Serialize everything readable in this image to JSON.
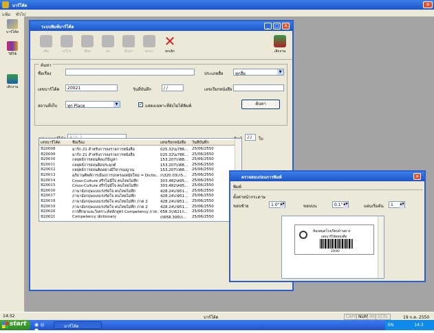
{
  "main_window": {
    "title": "บาร์โค้ด",
    "menu": [
      "แฟ้ม",
      "ทั่วไป"
    ]
  },
  "left_rail": [
    {
      "label": "บาร์โค้ด",
      "icon": "barcode-tool-icon"
    },
    {
      "label": "วิธีใช้",
      "icon": "books-icon"
    },
    {
      "label": "เลิกงาน",
      "icon": "exit-door-icon"
    }
  ],
  "inner_window": {
    "title": "ระบบพิมพ์บาร์โค้ด",
    "toolbar": [
      {
        "label": "เพิ่ม",
        "icon": "add-icon"
      },
      {
        "label": "แก้ไข",
        "icon": "edit-pencil-icon"
      },
      {
        "label": "เลือก",
        "icon": "select-icon"
      },
      {
        "label": "ลบ",
        "icon": "delete-icon"
      },
      {
        "label": "ค้นหา",
        "icon": "search-binoculars-icon"
      },
      {
        "label": "ตกลง",
        "icon": "check-icon"
      },
      {
        "label": "ยกเลิก",
        "icon": "cancel-x-icon"
      },
      {
        "label": "เลิกงาน",
        "icon": "exit-door-icon"
      }
    ],
    "search": {
      "group_label": "ค้นหา",
      "title_label": "ชื่อเรื่อง",
      "title_value": "",
      "type_label": "ประเภทสื่อ",
      "type_value": "ทุกสื่อ",
      "regno_label": "เลขบาร์โค้ด",
      "regno_value": "20021",
      "date_label": "วันที่บันทึก",
      "date_value": "/ /",
      "callno_label": "เลขเรียกหนังสือ",
      "callno_value": "",
      "place_label": "สถานที่เก็บ",
      "place_value": "ทุก Place",
      "checkbox_label": "แสดงเฉพาะที่ยังไม่ได้พิมพ์",
      "checkbox_checked": "✓",
      "search_button": "ค้นหา"
    },
    "format": {
      "label": "รูปแบบบาร์โค้ด",
      "value": "A10_2",
      "count_label": "พิมพ์",
      "count_value": "22",
      "unit": "ใบ"
    },
    "table": {
      "columns": [
        "เลขบาร์โค้ด",
        "ชื่อเรื่อง",
        "เลขเรียกหนังสือ",
        "วันที่บันทึก"
      ],
      "rows": [
        [
          "B20008",
          "มาร์ก 21 สำหรับการลงรายการหนังสือ",
          "025.32\\ม786...",
          "25/06/2550"
        ],
        [
          "B20009",
          "มาร์ก 21 สำหรับการลงรายการหนังสือ",
          "025.32\\ม786...",
          "25/06/2550"
        ],
        [
          "B20010",
          "กลยุทธ์การสอนคิดแก้ปัญหา",
          "153.207\\ก88...",
          "25/06/2550"
        ],
        [
          "B20011",
          "กลยุทธ์การสอนคิดประยุกต์",
          "153.207\\ก88...",
          "25/06/2550"
        ],
        [
          "B20012",
          "กลยุทธ์การสอนคิดอย่างมีวิจารณญาณ",
          "153.207\\ก88...",
          "25/06/2550"
        ],
        [
          "B20013",
          "อภิธานศัพท์การเมืองการปกครองสมัยใหม่ = Dictio...",
          "ก\\320.03\\ก5...",
          "25/06/2550"
        ],
        [
          "B20014",
          "Cross-Culture สรีรไม่มีใจ คนไทยไม่ทึก",
          "303.482\\ค95...",
          "25/06/2550"
        ],
        [
          "B20015",
          "Cross-Culture สรีรไม่มีใจ คนไทยไม่ทึก",
          "303.482\\ค95...",
          "25/06/2550"
        ],
        [
          "B20016",
          "ภาษาอังกฤษแบบเร่งรัดใจ คนไทยไม่ทึก",
          "428.24\\ภ951...",
          "25/06/2550"
        ],
        [
          "B20017",
          "ภาษาอังกฤษแบบเร่งรัดใจ คนไทยไม่ทึก",
          "428.24\\ภ951...",
          "25/06/2550"
        ],
        [
          "B20018",
          "ภาษาอังกฤษแบบเร่งรัดใจ คนไทยไม่ทึก ภาค 2",
          "428.24\\ภ951...",
          "25/06/2550"
        ],
        [
          "B20019",
          "ภาษาอังกฤษแบบเร่งรัดใจ คนไทยไม่ทึก ภาค 2",
          "428.24\\ภ951...",
          "25/06/2550"
        ],
        [
          "B20020",
          "การศึกษาและวิเคราะห์หลักสูตร Competency ภาค...",
          "658.3\\ก621ก...",
          "25/06/2550"
        ],
        [
          "B20021",
          "Competency dictionary",
          "ก\\658.306\\ก...",
          "25/06/2550"
        ]
      ]
    }
  },
  "print_dialog": {
    "title": "ตรวจสอบก่อนการพิมพ์",
    "menu": "พิมพ์",
    "group_label": "ตั้งค่าหน้ากระดาษ",
    "margin_left_label": "ขอบซ้าย",
    "margin_left_value": "1.0\"",
    "margin_top_label": "ขอบบน",
    "margin_top_value": "0.1\"",
    "start_label": "แผ่นเริ่มต้น",
    "start_value": "1",
    "label_line1": "ห้องสมุดโรงเรียนบ้านยาง",
    "label_line2": "เลขบาร์โค้ดหนังสือ",
    "label_code": "20000"
  },
  "status_bar": {
    "time": "14:32",
    "center": "บาร์โค้ด",
    "caps": "CAPS",
    "num": "NUM",
    "ins": "INS",
    "scrl": "SCRL",
    "date": "19 ก.ค. 2550"
  },
  "taskbar": {
    "start": "start",
    "app": "บาร์โค้ด",
    "lang": "EN",
    "clock": "14:3"
  },
  "colors": {
    "titlebar": "#2458d8",
    "workspace": "#a4a4a4",
    "window_bg": "#ece9d8",
    "close_red": "#e05030",
    "start_green": "#3a9a30"
  }
}
